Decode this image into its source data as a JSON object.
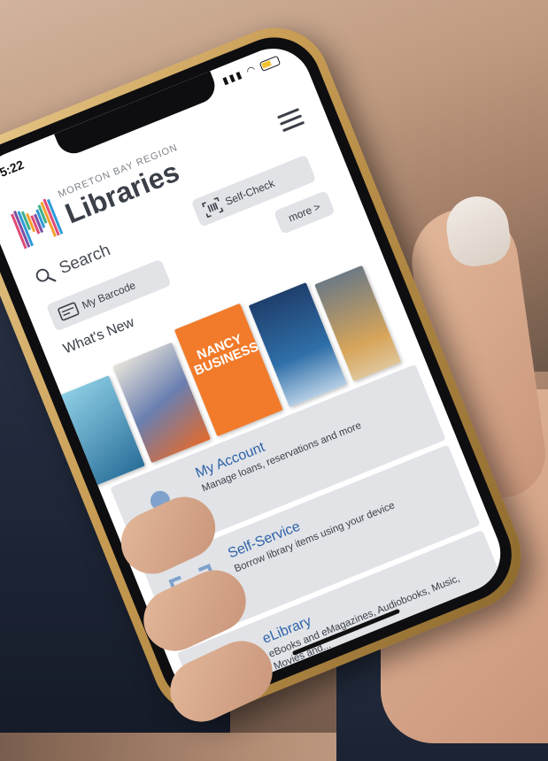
{
  "status_bar": {
    "time": "5:22"
  },
  "header": {
    "region": "MORETON BAY REGION",
    "title": "Libraries"
  },
  "toolbar": {
    "search_label": "Search",
    "self_check_label": "Self-Check",
    "my_barcode_label": "My Barcode",
    "more_label": "more >"
  },
  "whats_new": {
    "heading": "What's New",
    "books": [
      {
        "title": ""
      },
      {
        "title": ""
      },
      {
        "title": "NANCY BUSINESS"
      },
      {
        "title": ""
      },
      {
        "title": ""
      }
    ]
  },
  "cards": [
    {
      "title": "My Account",
      "description": "Manage loans, reservations and more",
      "icon": "person-icon"
    },
    {
      "title": "Self-Service",
      "description": "Borrow library items using your device",
      "icon": "barcode-scan-icon"
    },
    {
      "title": "eLibrary",
      "description": "eBooks and eMagazines, Audiobooks, Music, Movies and...",
      "icon": "tablet-icon"
    }
  ],
  "colors": {
    "accent": "#2e63a8",
    "card_bg": "#e1e3e7",
    "phone_frame": "#c79b52"
  }
}
